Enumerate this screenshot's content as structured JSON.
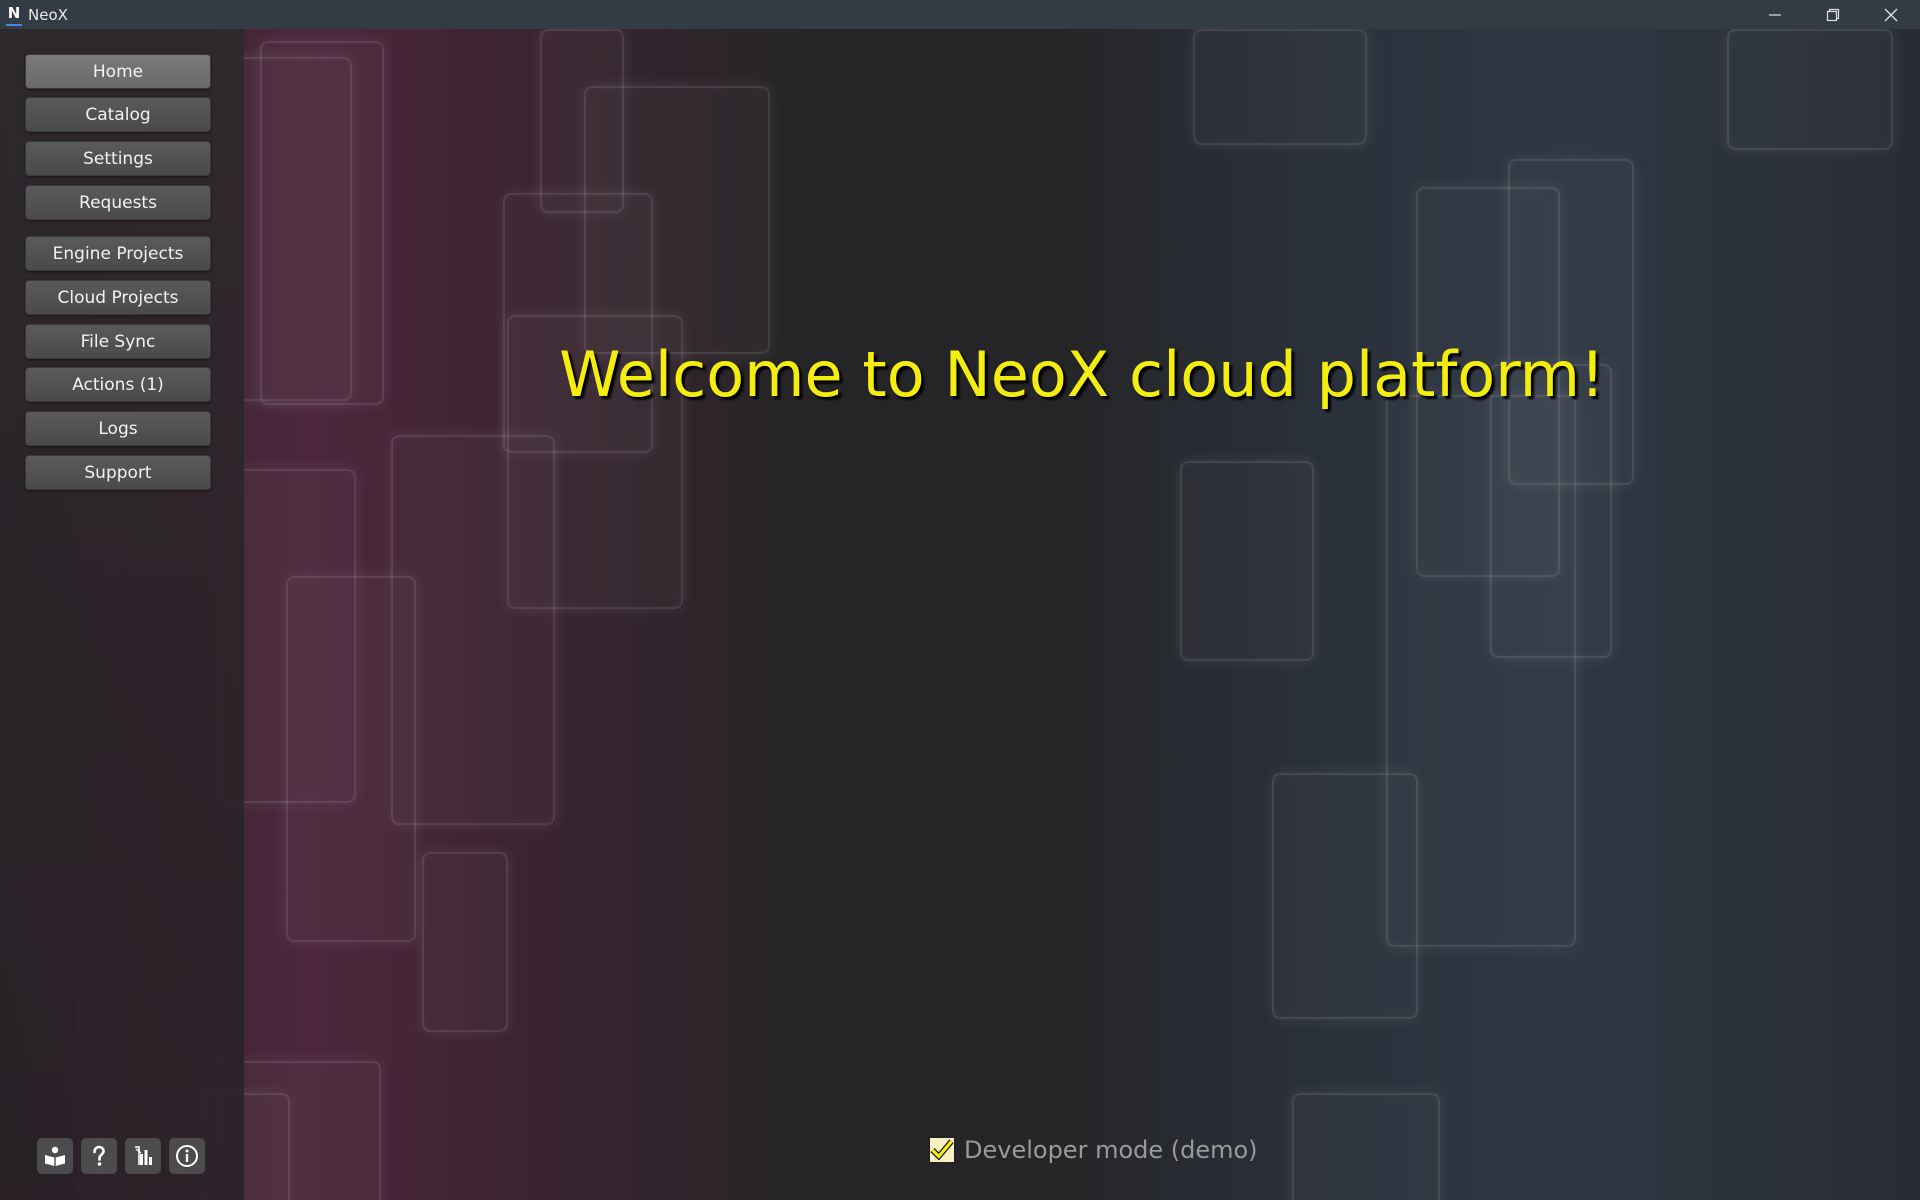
{
  "window": {
    "title": "NeoX",
    "logo_letter": "N",
    "controls": [
      "minimize-icon",
      "restore-icon",
      "close-icon"
    ]
  },
  "sidebar": {
    "items": [
      {
        "label": "Home",
        "active": true
      },
      {
        "label": "Catalog",
        "active": false
      },
      {
        "label": "Settings",
        "active": false
      },
      {
        "label": "Requests",
        "active": false
      },
      {
        "label": "Engine Projects",
        "active": false
      },
      {
        "label": "Cloud Projects",
        "active": false
      },
      {
        "label": "File Sync",
        "active": false
      },
      {
        "label": "Actions (1)",
        "active": false
      },
      {
        "label": "Logs",
        "active": false
      },
      {
        "label": "Support",
        "active": false
      }
    ],
    "tools": [
      {
        "icon": "book-icon"
      },
      {
        "icon": "help-icon"
      },
      {
        "icon": "document-chart-icon"
      },
      {
        "icon": "info-icon"
      }
    ]
  },
  "main": {
    "welcome_text": "Welcome to NeoX cloud platform!",
    "developer_mode": {
      "label": "Developer mode (demo)",
      "checked": true
    }
  },
  "colors": {
    "welcome_text": "#f4ee10",
    "checkbox_check": "#f4ee10",
    "titlebar": "#333b44",
    "button": "#4e4e50"
  }
}
